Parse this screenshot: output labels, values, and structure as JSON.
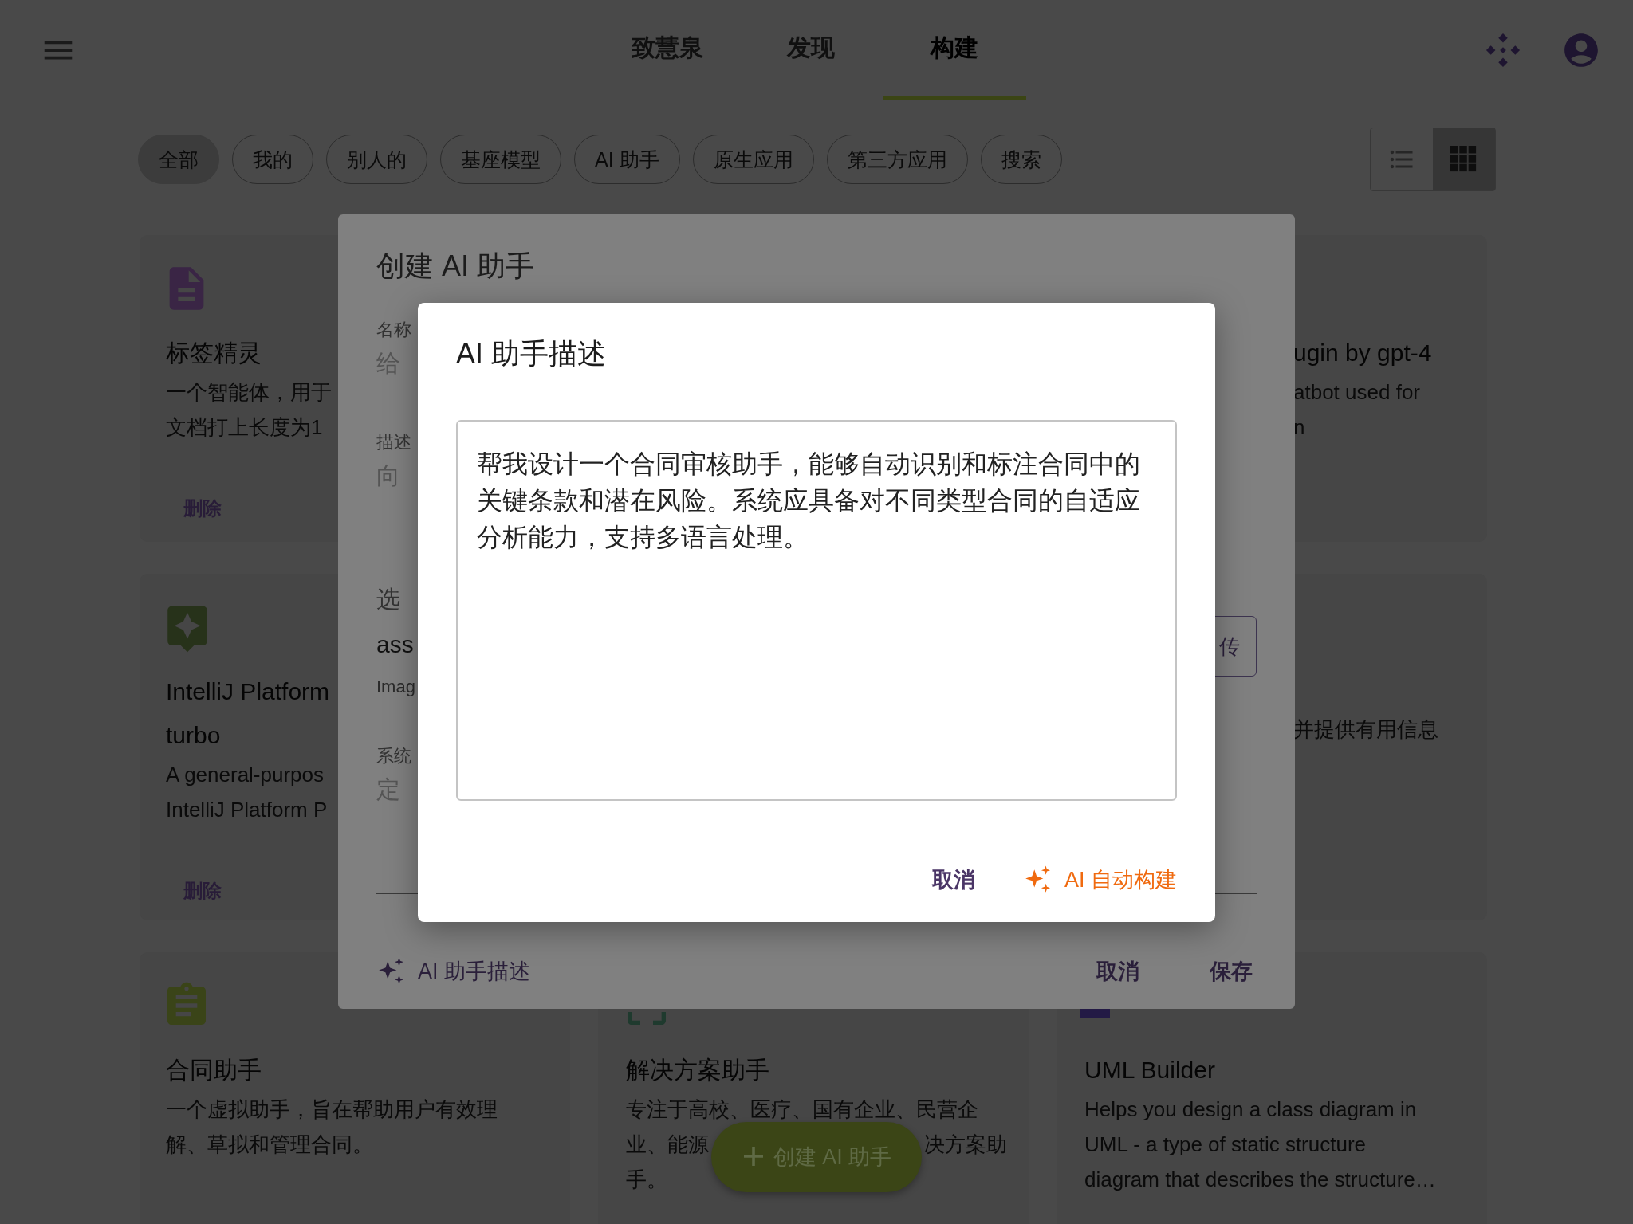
{
  "header": {
    "tabs": [
      {
        "label": "致慧泉",
        "selected": false
      },
      {
        "label": "发现",
        "selected": false
      },
      {
        "label": "构建",
        "selected": true
      }
    ]
  },
  "filters": [
    {
      "label": "全部",
      "selected": true
    },
    {
      "label": "我的",
      "selected": false
    },
    {
      "label": "别人的",
      "selected": false
    },
    {
      "label": "基座模型",
      "selected": false
    },
    {
      "label": "AI 助手",
      "selected": false
    },
    {
      "label": "原生应用",
      "selected": false
    },
    {
      "label": "第三方应用",
      "selected": false
    },
    {
      "label": "搜索",
      "selected": false
    }
  ],
  "view_toggle": [
    {
      "kind": "list",
      "selected": false
    },
    {
      "kind": "grid",
      "selected": true
    }
  ],
  "left_cards": [
    {
      "title_lines": [
        "标签精灵"
      ],
      "description_lines": [
        [
          "一个智能体，用于"
        ],
        [
          "文档打上长度为1"
        ]
      ],
      "action": "删除"
    },
    {
      "title_lines": [
        "IntelliJ Platform",
        "turbo"
      ],
      "description_lines": [
        [
          "A general-purpos"
        ],
        [
          "IntelliJ Platform P"
        ]
      ],
      "action": "删除"
    }
  ],
  "right_cards": [
    {
      "title_lines": [
        "ugin by gpt-4"
      ],
      "description_lines": [
        [
          "atbot used for"
        ],
        [
          "n"
        ]
      ]
    },
    {
      "description_lines": [
        [
          "并提供有用信息"
        ]
      ]
    }
  ],
  "bottom_cards": [
    {
      "title_lines": [
        "合同助手"
      ],
      "description_lines": [
        [
          "一个虚拟助手，旨在帮助用户有效理"
        ],
        [
          "解、草拟和管理合同。"
        ]
      ]
    },
    {
      "title_lines": [
        "解决方案助手"
      ],
      "description_lines": [
        [
          "专注于高校、医疗、国有企业、民营企"
        ],
        [
          "业、能源",
          "决方案助"
        ],
        [
          "手。"
        ]
      ]
    },
    {
      "title_lines": [
        "UML Builder"
      ],
      "description_lines": [
        [
          "Helps you design a class diagram in"
        ],
        [
          "UML - a type of static structure"
        ],
        [
          "diagram that describes the structure…"
        ]
      ]
    }
  ],
  "create_dialog": {
    "title": "创建 AI 助手",
    "fields": [
      {
        "kind": "text",
        "label": "名称",
        "placeholder": "给"
      },
      {
        "kind": "multiline",
        "label": "描述",
        "placeholder": "向"
      },
      {
        "kind": "select",
        "label": "选",
        "value": "ass",
        "helper": "Imag",
        "button": "传"
      },
      {
        "kind": "multiline",
        "label": "系统",
        "placeholder": "定"
      }
    ],
    "footer_link": "AI 助手描述",
    "buttons": [
      "取消",
      "保存"
    ]
  },
  "description_dialog": {
    "title": "AI 助手描述",
    "value": "帮我设计一个合同审核助手，能够自动识别和标注合同中的关键条款和潜在风险。系统应具备对不同类型合同的自适应分析能力，支持多语言处理。",
    "buttons": [
      {
        "kind": "text",
        "label": "取消"
      },
      {
        "kind": "ai",
        "label": "AI 自动构建"
      }
    ]
  },
  "fab": {
    "label": "创建 AI 助手"
  }
}
